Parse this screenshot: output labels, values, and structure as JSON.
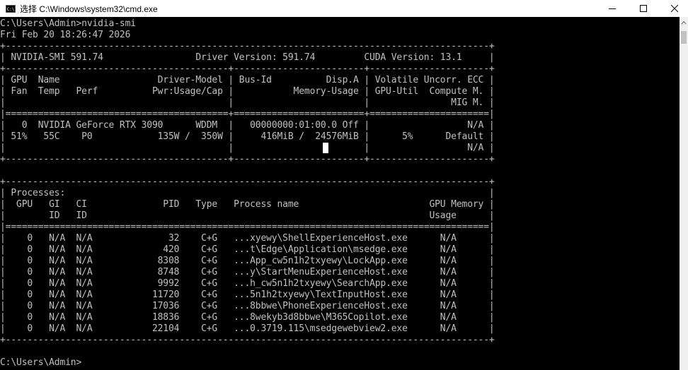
{
  "window": {
    "title": "选择 C:\\Windows\\system32\\cmd.exe",
    "app_icon_text": "C:\\",
    "controls": {
      "minimize": "minimize-icon",
      "maximize": "maximize-icon",
      "close": "close-icon"
    }
  },
  "console": {
    "lines": [
      "C:\\Users\\Admin>nvidia-smi",
      "Fri Feb 20 18:26:47 2026",
      "+-----------------------------------------------------------------------------------------+",
      "| NVIDIA-SMI 591.74                 Driver Version: 591.74         CUDA Version: 13.1     |",
      "+-----------------------------------------+------------------------+----------------------+",
      "| GPU  Name                  Driver-Model | Bus-Id          Disp.A | Volatile Uncorr. ECC |",
      "| Fan  Temp   Perf          Pwr:Usage/Cap |           Memory-Usage | GPU-Util  Compute M. |",
      "|                                         |                        |               MIG M. |",
      "|=========================================+========================+======================|",
      "|   0  NVIDIA GeForce RTX 3090      WDDM  |   00000000:01:00.0 Off |                  N/A |",
      "| 51%   55C    P0            135W /  350W |     416MiB /  24576MiB |      5%      Default |",
      "|                                         |                        |                  N/A |",
      "+-----------------------------------------+------------------------+----------------------+",
      "",
      "+-----------------------------------------------------------------------------------------+",
      "| Processes:                                                                              |",
      "|  GPU   GI   CI              PID   Type   Process name                        GPU Memory |",
      "|        ID   ID                                                               Usage      |",
      "|=========================================================================================|",
      "|    0   N/A  N/A              32    C+G   ...xyewy\\ShellExperienceHost.exe      N/A      |",
      "|    0   N/A  N/A             420    C+G   ...t\\Edge\\Application\\msedge.exe      N/A      |",
      "|    0   N/A  N/A            8308    C+G   ...App_cw5n1h2txyewy\\LockApp.exe      N/A      |",
      "|    0   N/A  N/A            8748    C+G   ...y\\StartMenuExperienceHost.exe      N/A      |",
      "|    0   N/A  N/A            9992    C+G   ...h_cw5n1h2txyewy\\SearchApp.exe      N/A      |",
      "|    0   N/A  N/A           11720    C+G   ...5n1h2txyewy\\TextInputHost.exe      N/A      |",
      "|    0   N/A  N/A           17036    C+G   ...8bbwe\\PhoneExperienceHost.exe      N/A      |",
      "|    0   N/A  N/A           18836    C+G   ...8wekyb3d8bbwe\\M365Copilot.exe      N/A      |",
      "|    0   N/A  N/A           22104    C+G   ...0.3719.115\\msedgewebview2.exe      N/A      |",
      "+-----------------------------------------------------------------------------------------+",
      "",
      "C:\\Users\\Admin>"
    ]
  }
}
